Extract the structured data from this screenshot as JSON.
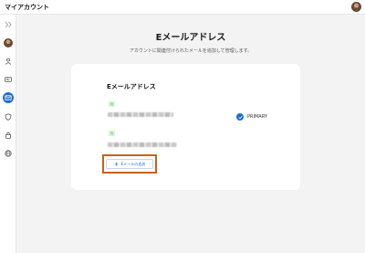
{
  "header": {
    "app_title": "マイアカウント"
  },
  "sidebar": {
    "items": [
      {
        "icon": "collapse-icon"
      },
      {
        "icon": "avatar"
      },
      {
        "icon": "person-icon"
      },
      {
        "icon": "id-card-icon"
      },
      {
        "icon": "mail-icon",
        "active": true
      },
      {
        "icon": "shield-icon"
      },
      {
        "icon": "lock-icon"
      },
      {
        "icon": "globe-icon"
      }
    ]
  },
  "main": {
    "title": "Eメールアドレス",
    "subtitle": "アカウントに関連付けられたメールを追加して管理します。",
    "card": {
      "section_title": "Eメールアドレス",
      "emails": [
        {
          "tag": "済",
          "badge": "PRIMARY"
        },
        {
          "tag": "済"
        }
      ],
      "add_button_label": "Eメールの追加"
    }
  },
  "colors": {
    "accent": "#1f6fd1",
    "highlight_border": "#c8611f",
    "verified_tag": "#d6f5d6"
  }
}
